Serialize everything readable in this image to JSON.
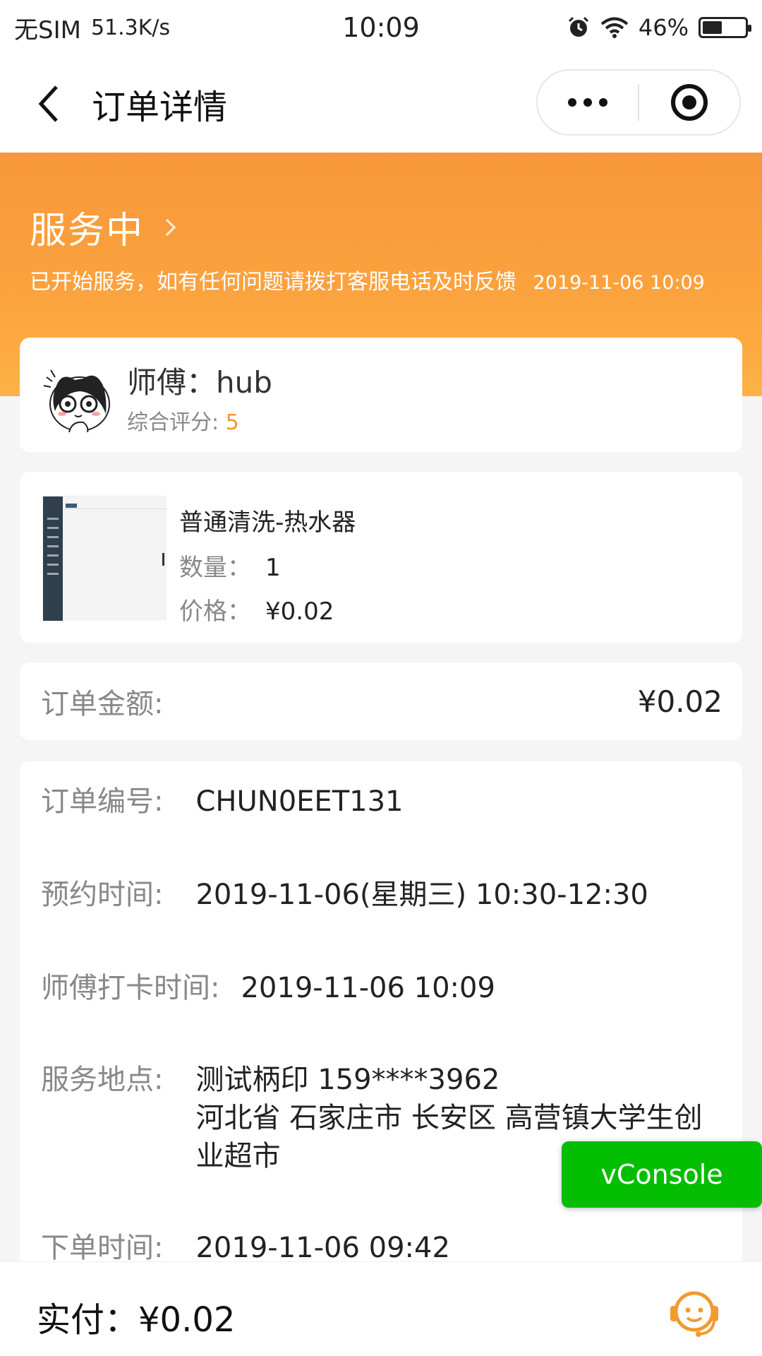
{
  "status_bar": {
    "carrier": "无SIM",
    "speed": "51.3K/s",
    "time": "10:09",
    "battery": "46%",
    "battery_level": 0.46,
    "icons": [
      "alarm-icon",
      "wifi-icon",
      "battery-icon"
    ]
  },
  "nav": {
    "title": "订单详情",
    "icons": [
      "back-icon",
      "more-icon",
      "capsule-close-icon"
    ]
  },
  "banner": {
    "status": "服务中",
    "tip": "已开始服务，如有任何问题请拨打客服电话及时反馈",
    "tip_time": "2019-11-06 10:09"
  },
  "worker": {
    "name": "师傅：hub",
    "rating_label": "综合评分:",
    "rating_value": "5"
  },
  "product": {
    "name": "普通清洗-热水器",
    "qty_label": "数量：",
    "qty": "1",
    "price_label": "价格：",
    "price": "¥0.02"
  },
  "amount": {
    "label": "订单金额:",
    "value": "¥0.02"
  },
  "details": {
    "order_no_label": "订单编号:",
    "order_no": "CHUN0EET131",
    "appointment_label": "预约时间:",
    "appointment": "2019-11-06(星期三) 10:30-12:30",
    "checkin_label": "师傅打卡时间:",
    "checkin": "2019-11-06 10:09",
    "address_label": "服务地点:",
    "address_contact": "测试柄印 159****3962",
    "address": "河北省 石家庄市 长安区 高营镇大学生创业超市",
    "order_time_label": "下单时间:",
    "order_time": "2019-11-06 09:42"
  },
  "vconsole": "vConsole",
  "bottom": {
    "paid": "实付：¥0.02"
  },
  "colors": {
    "accent": "#f7973a",
    "rating": "#f29a2e",
    "vconsole": "#04be02"
  }
}
